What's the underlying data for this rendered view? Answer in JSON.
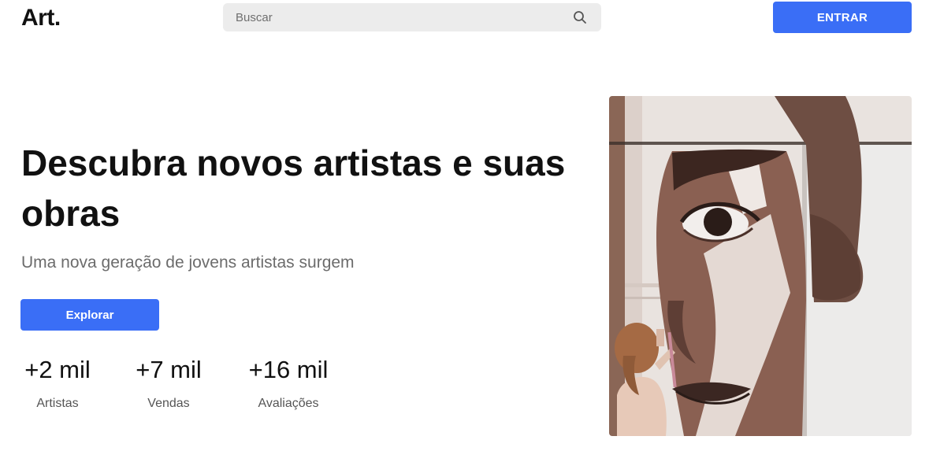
{
  "header": {
    "logo": "Art.",
    "search": {
      "placeholder": "Buscar",
      "icon": "search-icon"
    },
    "login_label": "ENTRAR"
  },
  "hero": {
    "title": "Descubra novos artistas e suas obras",
    "subtitle": "Uma nova geração de jovens artistas surgem",
    "cta_label": "Explorar",
    "stats": [
      {
        "value": "+2 mil",
        "label": "Artistas"
      },
      {
        "value": "+7 mil",
        "label": "Vendas"
      },
      {
        "value": "+16 mil",
        "label": "Avaliações"
      }
    ]
  },
  "colors": {
    "accent": "#3a6ef6",
    "text": "#111111",
    "muted": "#6c6c6c",
    "search_bg": "#ececec"
  }
}
